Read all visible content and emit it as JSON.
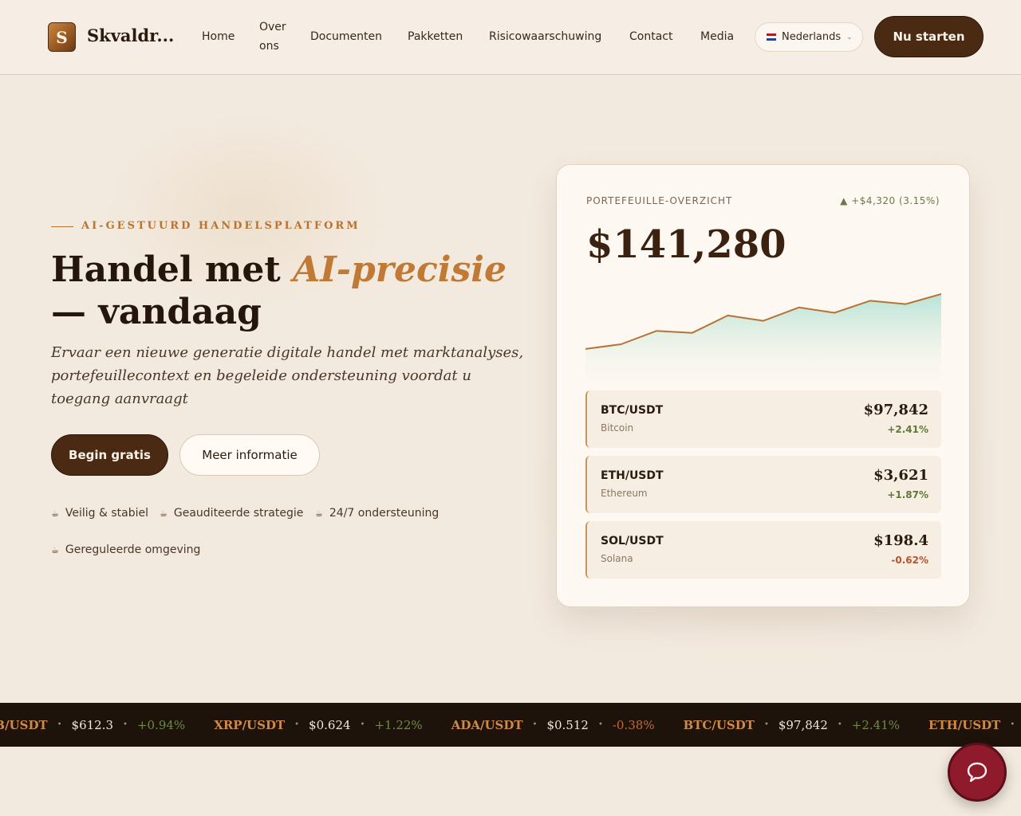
{
  "nav": {
    "logo_letter": "S",
    "brand": "Skvaldr...",
    "links": [
      "Home",
      "Over ons",
      "Documenten",
      "Pakketten",
      "Risicowaarschuwing",
      "Contact",
      "Media"
    ],
    "language": "Nederlands",
    "cta": "Nu starten"
  },
  "hero": {
    "eyebrow": "AI-GESTUURD HANDELSPLATFORM",
    "headline_part1": "Handel met ",
    "headline_accent": "AI-precisie",
    "headline_part2": "— vandaag",
    "subtitle": "Ervaar een nieuwe generatie digitale handel met marktanalyses, portefeuillecontext en begeleide ondersteuning voordat u toegang aanvraagt",
    "primary_button": "Begin gratis",
    "secondary_button": "Meer informatie",
    "badges": [
      "Veilig & stabiel",
      "Geauditeerde strategie",
      "24/7 ondersteuning",
      "Gereguleerde omgeving"
    ]
  },
  "card": {
    "label": "PORTEFEUILLE-OVERZICHT",
    "change": "▲ +$4,320 (3.15%)",
    "value": "$141,280",
    "chart_values": [
      0.18,
      0.25,
      0.45,
      0.42,
      0.68,
      0.6,
      0.8,
      0.72,
      0.9,
      0.85,
      1.0
    ],
    "assets": [
      {
        "pair": "BTC/USDT",
        "name": "Bitcoin",
        "price": "$97,842",
        "change": "+2.41%",
        "positive": true
      },
      {
        "pair": "ETH/USDT",
        "name": "Ethereum",
        "price": "$3,621",
        "change": "+1.87%",
        "positive": true
      },
      {
        "pair": "SOL/USDT",
        "name": "Solana",
        "price": "$198.4",
        "change": "-0.62%",
        "positive": false
      }
    ]
  },
  "ticker": [
    {
      "pair": "BNB/USDT",
      "price": "$612.3",
      "change": "+0.94%",
      "positive": true
    },
    {
      "pair": "XRP/USDT",
      "price": "$0.624",
      "change": "+1.22%",
      "positive": true
    },
    {
      "pair": "ADA/USDT",
      "price": "$0.512",
      "change": "-0.38%",
      "positive": false
    },
    {
      "pair": "BTC/USDT",
      "price": "$97,842",
      "change": "+2.41%",
      "positive": true
    },
    {
      "pair": "ETH/USDT",
      "price": "$3,621",
      "change": "+1.87%",
      "positive": true
    }
  ],
  "colors": {
    "brand_dark": "#4a2a12",
    "accent": "#c07a35",
    "positive": "#5d7a3a",
    "negative": "#b3552c",
    "chat": "#8e1a2b"
  },
  "icons": [
    "coffee-cup-icon",
    "chevron-down-icon",
    "flag-nl-icon",
    "chat-bubble-icon",
    "triangle-up-icon"
  ]
}
